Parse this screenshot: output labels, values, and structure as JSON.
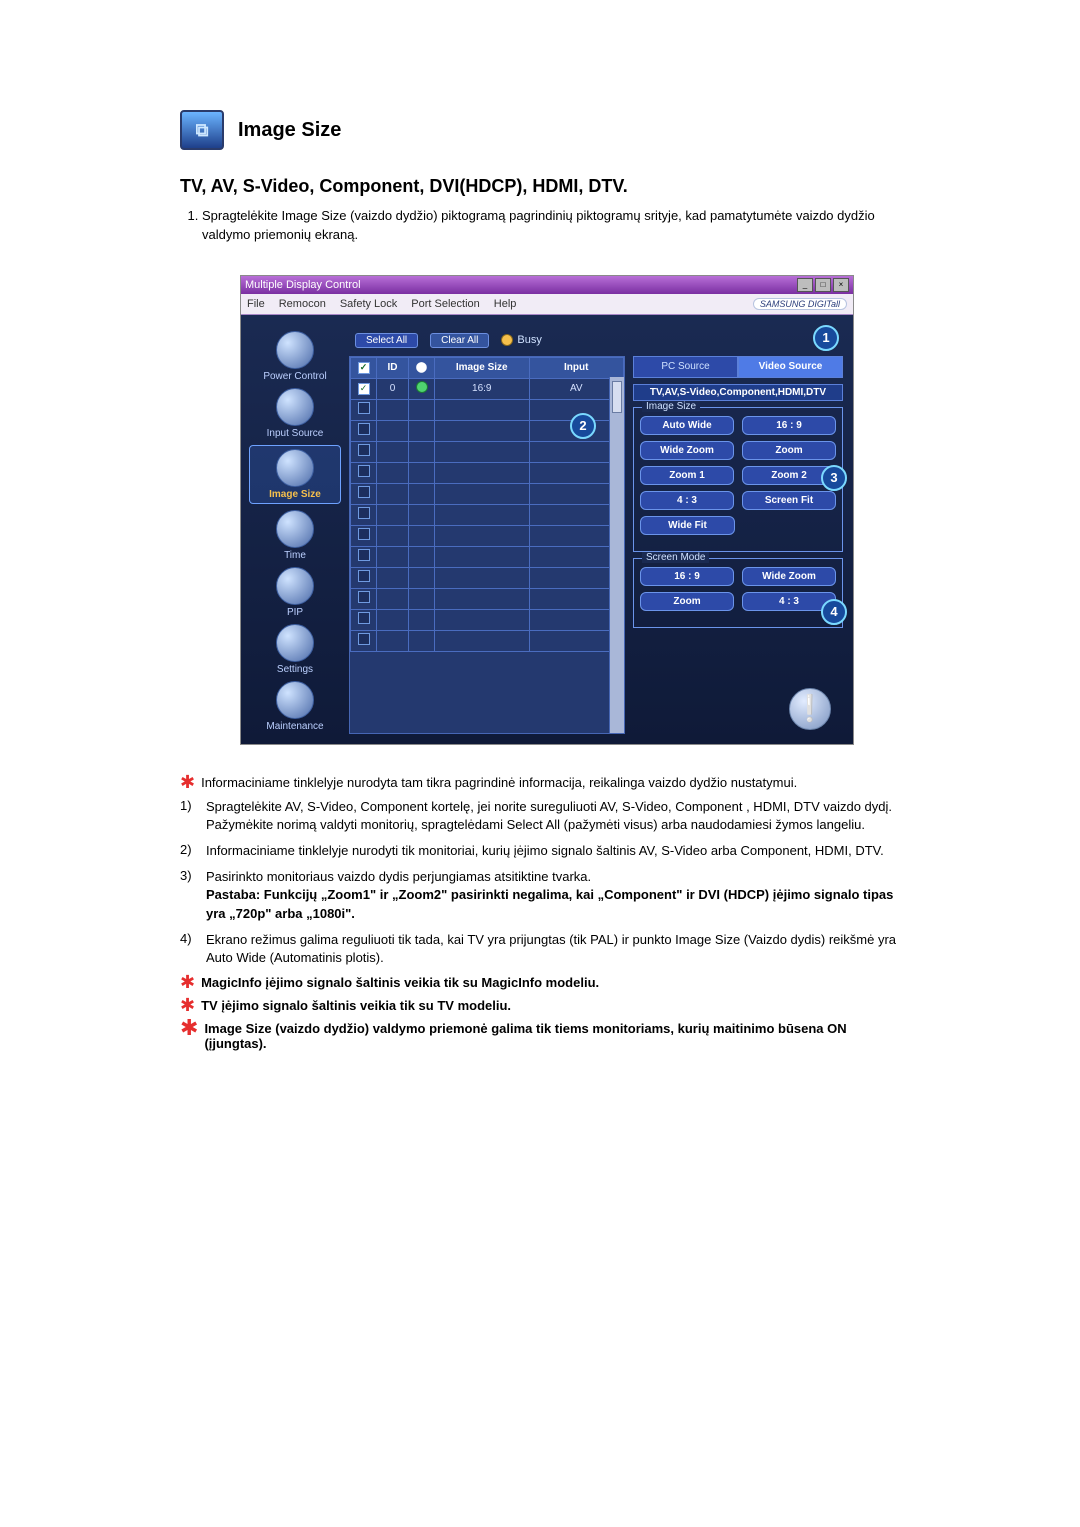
{
  "heading": {
    "title": "Image Size",
    "subtitle": "TV, AV, S-Video, Component, DVI(HDCP), HDMI, DTV."
  },
  "intro_list": {
    "item1": "Spragtelėkite Image Size (vaizdo dydžio) piktogramą pagrindinių piktogramų srityje, kad pamatytumėte vaizdo dydžio valdymo priemonių ekraną."
  },
  "window": {
    "title": "Multiple Display Control",
    "menu": {
      "file": "File",
      "remocon": "Remocon",
      "safety": "Safety Lock",
      "port": "Port Selection",
      "help": "Help"
    },
    "brand": "SAMSUNG DIGITall",
    "sidebar": {
      "power": "Power Control",
      "input": "Input Source",
      "image": "Image Size",
      "time": "Time",
      "pip": "PIP",
      "settings": "Settings",
      "maint": "Maintenance"
    },
    "toolbar": {
      "select_all": "Select All",
      "clear_all": "Clear All",
      "busy": "Busy"
    },
    "grid": {
      "col_id": "ID",
      "col_size": "Image Size",
      "col_input": "Input",
      "row_id": "0",
      "row_size": "16:9",
      "row_input": "AV"
    },
    "tabs": {
      "pc": "PC Source",
      "video": "Video Source"
    },
    "subhead": "TV,AV,S-Video,Component,HDMI,DTV",
    "group_image": "Image Size",
    "btns_image": {
      "autowide": "Auto Wide",
      "r16_9": "16 : 9",
      "widezoom": "Wide Zoom",
      "zoom": "Zoom",
      "zoom1": "Zoom 1",
      "zoom2": "Zoom 2",
      "r4_3": "4 : 3",
      "screenfit": "Screen Fit",
      "widefit": "Wide Fit"
    },
    "group_screen": "Screen Mode",
    "btns_screen": {
      "r16_9": "16 : 9",
      "widezoom": "Wide Zoom",
      "zoom": "Zoom",
      "r4_3": "4 : 3"
    },
    "callouts": {
      "c1": "1",
      "c2": "2",
      "c3": "3",
      "c4": "4"
    }
  },
  "notes": {
    "star1": "Informaciniame tinklelyje nurodyta tam tikra pagrindinė informacija, reikalinga vaizdo dydžio nustatymui.",
    "n1a": "Spragtelėkite AV, S-Video, Component kortelę, jei norite sureguliuoti AV, S-Video, Component , HDMI, DTV vaizdo dydį.",
    "n1b": "Pažymėkite norimą valdyti monitorių, spragtelėdami Select All (pažymėti visus) arba naudodamiesi žymos langeliu.",
    "n2": "Informaciniame tinklelyje nurodyti tik monitoriai, kurių įėjimo signalo šaltinis AV, S-Video arba Component, HDMI, DTV.",
    "n3a": "Pasirinkto monitoriaus vaizdo dydis perjungiamas atsitiktine tvarka.",
    "n3b": "Pastaba: Funkcijų „Zoom1\" ir „Zoom2\" pasirinkti negalima, kai „Component\" ir DVI (HDCP) įėjimo signalo tipas yra „720p\" arba „1080i\".",
    "n4": "Ekrano režimus galima reguliuoti tik tada, kai TV yra prijungtas (tik PAL) ir punkto Image Size (Vaizdo dydis) reikšmė yra Auto Wide (Automatinis plotis).",
    "star2": "MagicInfo įėjimo signalo šaltinis veikia tik su MagicInfo modeliu.",
    "star3": "TV įėjimo signalo šaltinis veikia tik su TV modeliu.",
    "star4": "Image Size (vaizdo dydžio) valdymo priemonė galima tik tiems monitoriams, kurių maitinimo būsena ON (įjungtas)."
  },
  "labels": {
    "n1": "1)",
    "n2": "2)",
    "n3": "3)",
    "n4": "4)"
  }
}
